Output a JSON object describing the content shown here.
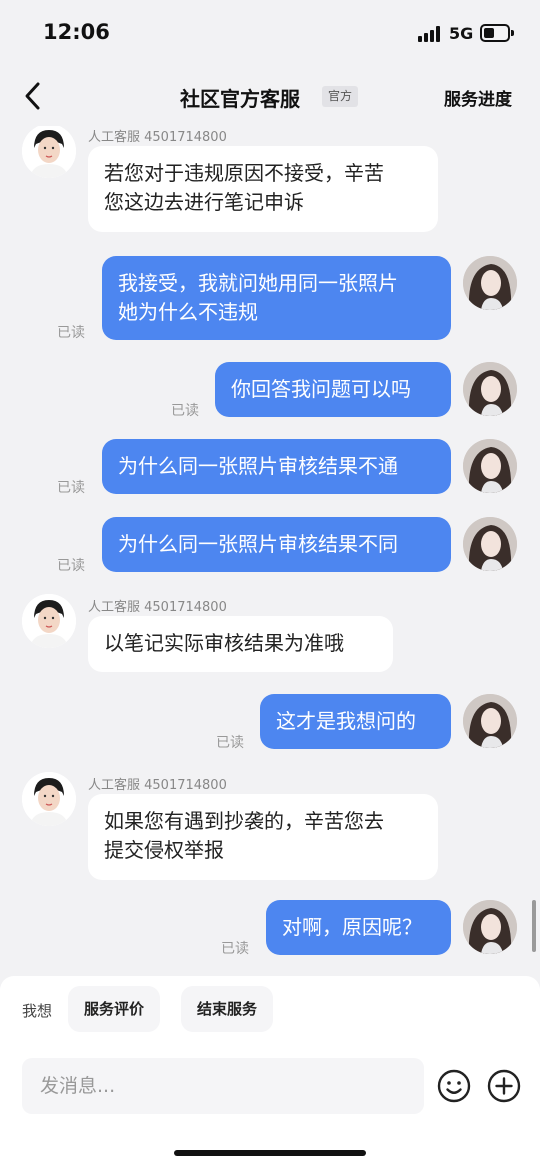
{
  "status": {
    "time": "12:06",
    "network": "5G"
  },
  "nav": {
    "title": "社区官方客服",
    "tag": "官方",
    "right_link": "服务进度",
    "back_icon": "chevron-left-icon"
  },
  "agent": {
    "label": "人工客服 4501714800"
  },
  "messages": [
    {
      "from": "agent",
      "line1": "若您对于违规原因不接受，辛苦",
      "line2": "您这边去进行笔记申诉"
    },
    {
      "from": "user",
      "line1": "我接受，我就问她用同一张照片",
      "line2": "她为什么不违规",
      "status": "已读"
    },
    {
      "from": "user",
      "line1": "你回答我问题可以吗",
      "status": "已读"
    },
    {
      "from": "user",
      "line1": "为什么同一张照片审核结果不通",
      "status": "已读"
    },
    {
      "from": "user",
      "line1": "为什么同一张照片审核结果不同",
      "status": "已读"
    },
    {
      "from": "agent",
      "line1": "以笔记实际审核结果为准哦"
    },
    {
      "from": "user",
      "line1": "这才是我想问的",
      "status": "已读"
    },
    {
      "from": "agent",
      "line1": "如果您有遇到抄袭的，辛苦您去",
      "line2": "提交侵权举报"
    },
    {
      "from": "user",
      "line1": "对啊，原因呢？",
      "status": "已读"
    }
  ],
  "quick": {
    "label": "我想",
    "options": [
      "服务评价",
      "结束服务"
    ]
  },
  "input": {
    "placeholder": "发消息..."
  },
  "icons": {
    "emoji": "smiley-icon",
    "plus": "plus-circle-icon"
  },
  "colors": {
    "user_bubble": "#4d86f0",
    "agent_bubble": "#ffffff",
    "background": "#f2f2f4"
  }
}
